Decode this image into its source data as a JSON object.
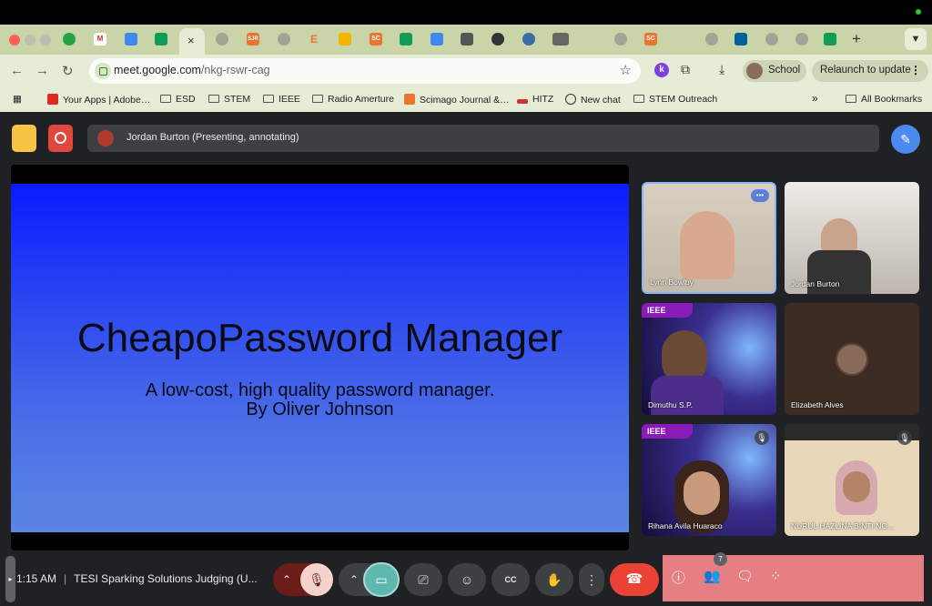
{
  "browser": {
    "url_host": "meet.google.com",
    "url_path": "/nkg-rswr-cag",
    "profile_label": "School",
    "relaunch_label": "Relaunch to update",
    "tab_close": "×",
    "tab_plus": "+",
    "tab_badges": [
      "M",
      "SJR",
      "E",
      "SC",
      "SC"
    ]
  },
  "bookmarks": [
    {
      "label": "Your Apps | Adobe…",
      "icon": "adobe-icon"
    },
    {
      "label": "ESD",
      "icon": "folder-icon"
    },
    {
      "label": "STEM",
      "icon": "folder-icon"
    },
    {
      "label": "IEEE",
      "icon": "folder-icon"
    },
    {
      "label": "Radio Amerture",
      "icon": "folder-icon"
    },
    {
      "label": "Scimago Journal &…",
      "icon": "sjr-icon"
    },
    {
      "label": "HITZ",
      "icon": "hitz-icon"
    },
    {
      "label": "New chat",
      "icon": "chat-icon"
    },
    {
      "label": "STEM Outreach",
      "icon": "folder-icon"
    }
  ],
  "bookmarks_more": "»",
  "all_bookmarks": "All Bookmarks",
  "meet": {
    "presenter_text": "Jordan Burton (Presenting, annotating)",
    "slide": {
      "title": "CheapoPassword Manager",
      "subtitle_line1": "A low-cost, high quality password manager.",
      "subtitle_line2": "By Oliver Johnson"
    },
    "participants": [
      {
        "name": "Lynn Bowlby"
      },
      {
        "name": "Jordan Burton"
      },
      {
        "name": "Dimuthu S.P.",
        "tag": "IEEE"
      },
      {
        "name": "Elizabeth Alves"
      },
      {
        "name": "Rihana Avila Huaraco",
        "tag": "IEEE"
      },
      {
        "name": "NURUL HAZLINA BINTI NO..."
      }
    ],
    "tile_more": "•••",
    "time": "1:15 AM",
    "separator": "|",
    "meeting_title": "TESI Sparking Solutions Judging (U...",
    "people_count": "7"
  },
  "colors": {
    "tabstrip": "#c9d5a9",
    "toolbar": "#e7ecd6",
    "meet_bg": "#202124",
    "hangup": "#ea4335",
    "right_panel": "#e67f83",
    "annotate": "#4d8af0"
  }
}
